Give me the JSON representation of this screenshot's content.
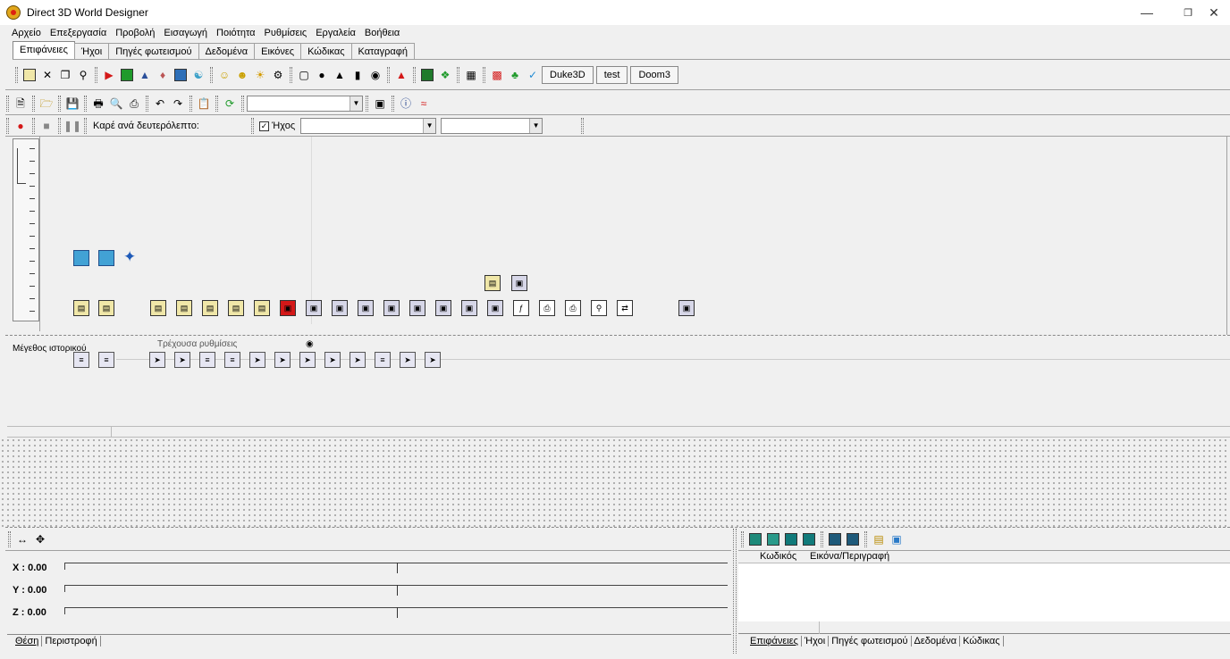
{
  "window": {
    "title": "Direct 3D World Designer",
    "min_icon": "minimize-icon",
    "max_icon": "restore-icon",
    "close_icon": "close-icon"
  },
  "menu": [
    "Αρχείο",
    "Επεξεργασία",
    "Προβολή",
    "Εισαγωγή",
    "Ποιότητα",
    "Ρυθμίσεις",
    "Εργαλεία",
    "Βοήθεια"
  ],
  "tabs": [
    "Επιφάνειες",
    "Ήχοι",
    "Πηγές φωτεισμού",
    "Δεδομένα",
    "Εικόνες",
    "Κώδικας",
    "Καταγραφή"
  ],
  "active_tab": 0,
  "toolbar1": {
    "buttons": [
      "Duke3D",
      "test",
      "Doom3"
    ]
  },
  "toolbar3": {
    "fps_label": "Καρέ ανά δευτερόλεπτο:",
    "sound_label": "Ήχος",
    "sound_checked": true
  },
  "middle": {
    "history_label": "Μέγεθος ιστορικού",
    "current_label": "Τρέχουσα ρυθμίσεις"
  },
  "coords": {
    "x": "X : 0.00",
    "y": "Y : 0.00",
    "z": "Z : 0.00"
  },
  "bottom_tabs_left": [
    "Θέση",
    "Περιστροφή"
  ],
  "list": {
    "col1": "Κωδικός",
    "col2": "Εικόνα/Περιγραφή"
  },
  "bottom_tabs_right": [
    "Επιφάνειες",
    "Ήχοι",
    "Πηγές φωτεισμού",
    "Δεδομένα",
    "Κώδικας"
  ],
  "colors": {
    "accent_red": "#d41818",
    "accent_green": "#1f9a2b",
    "icon_yellow": "#f0e7a8"
  }
}
